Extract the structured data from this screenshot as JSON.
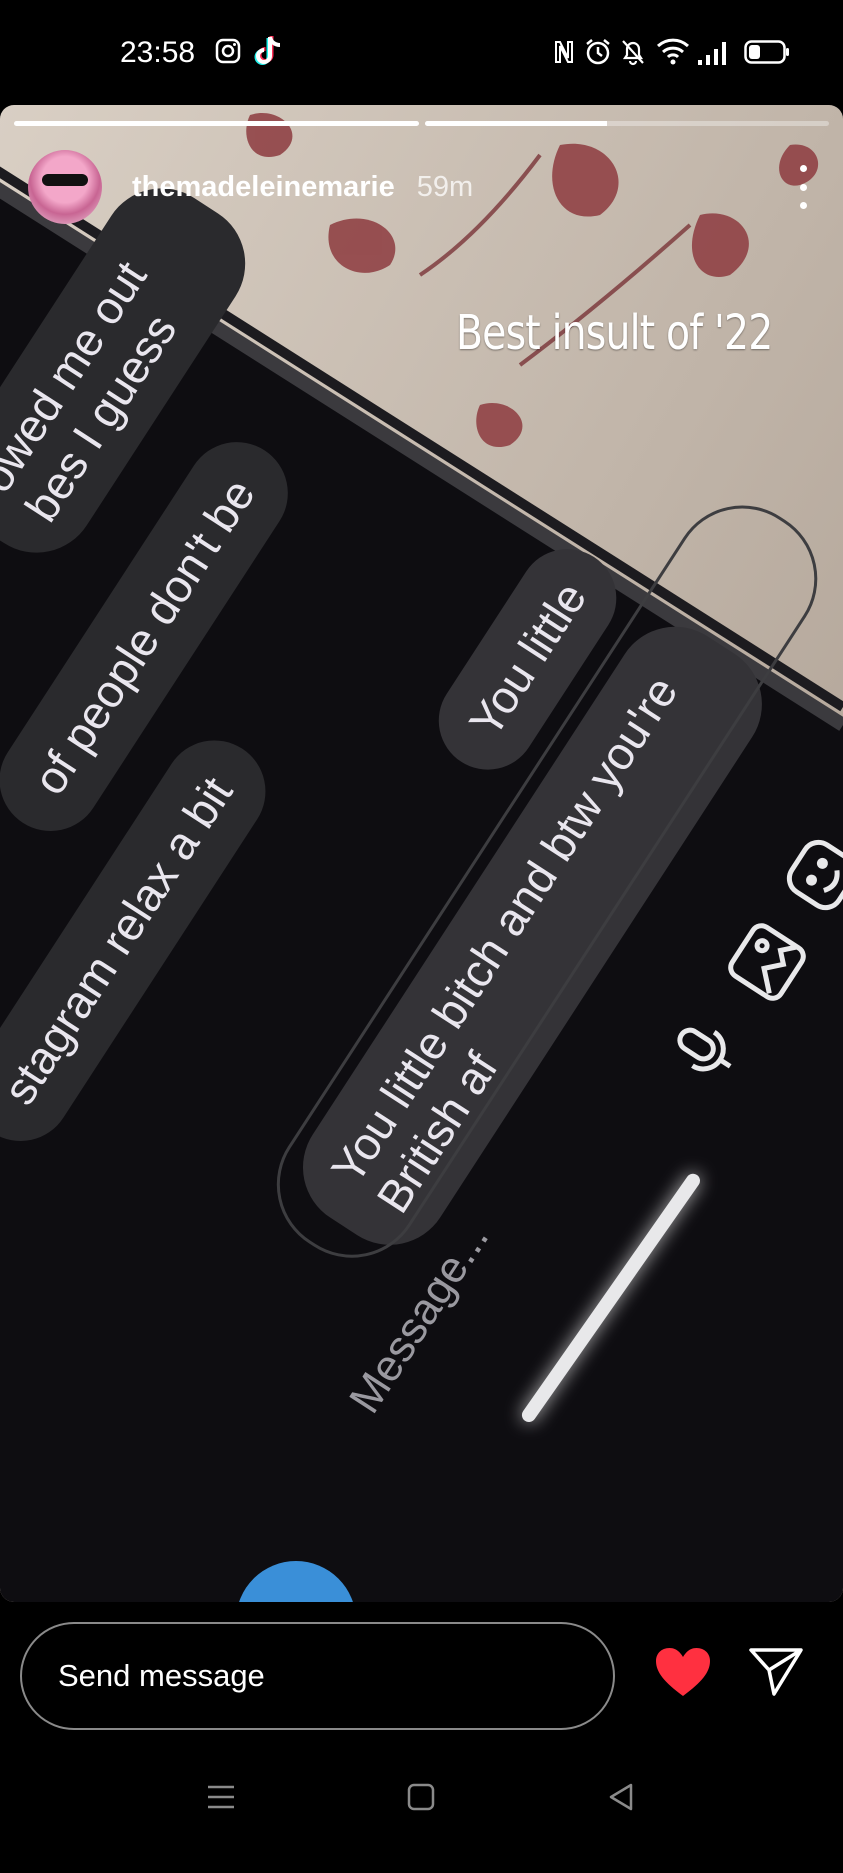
{
  "status_bar": {
    "time": "23:58",
    "left_icons": [
      "instagram-icon",
      "tiktok-icon"
    ],
    "right_icons": [
      "nfc-icon",
      "alarm-icon",
      "muted-bell-icon",
      "wifi-icon",
      "signal-icon",
      "battery-icon"
    ]
  },
  "story": {
    "progress_segments": [
      1.0,
      0.45
    ],
    "username": "themadeleinemarie",
    "time_ago": "59m",
    "caption": "Best insult of '22",
    "photo": {
      "bubbles": [
        {
          "text": "owed me out"
        },
        {
          "text": "bes I guess"
        },
        {
          "text": "of people don't be"
        },
        {
          "text": "stagram relax a bit"
        },
        {
          "text": "You little"
        },
        {
          "text": "You little bitch and btw you're"
        },
        {
          "text": "British af"
        }
      ],
      "message_placeholder": "Message..."
    }
  },
  "reply": {
    "placeholder": "Send message"
  },
  "colors": {
    "heart": "#ff3040",
    "background": "#000000"
  }
}
